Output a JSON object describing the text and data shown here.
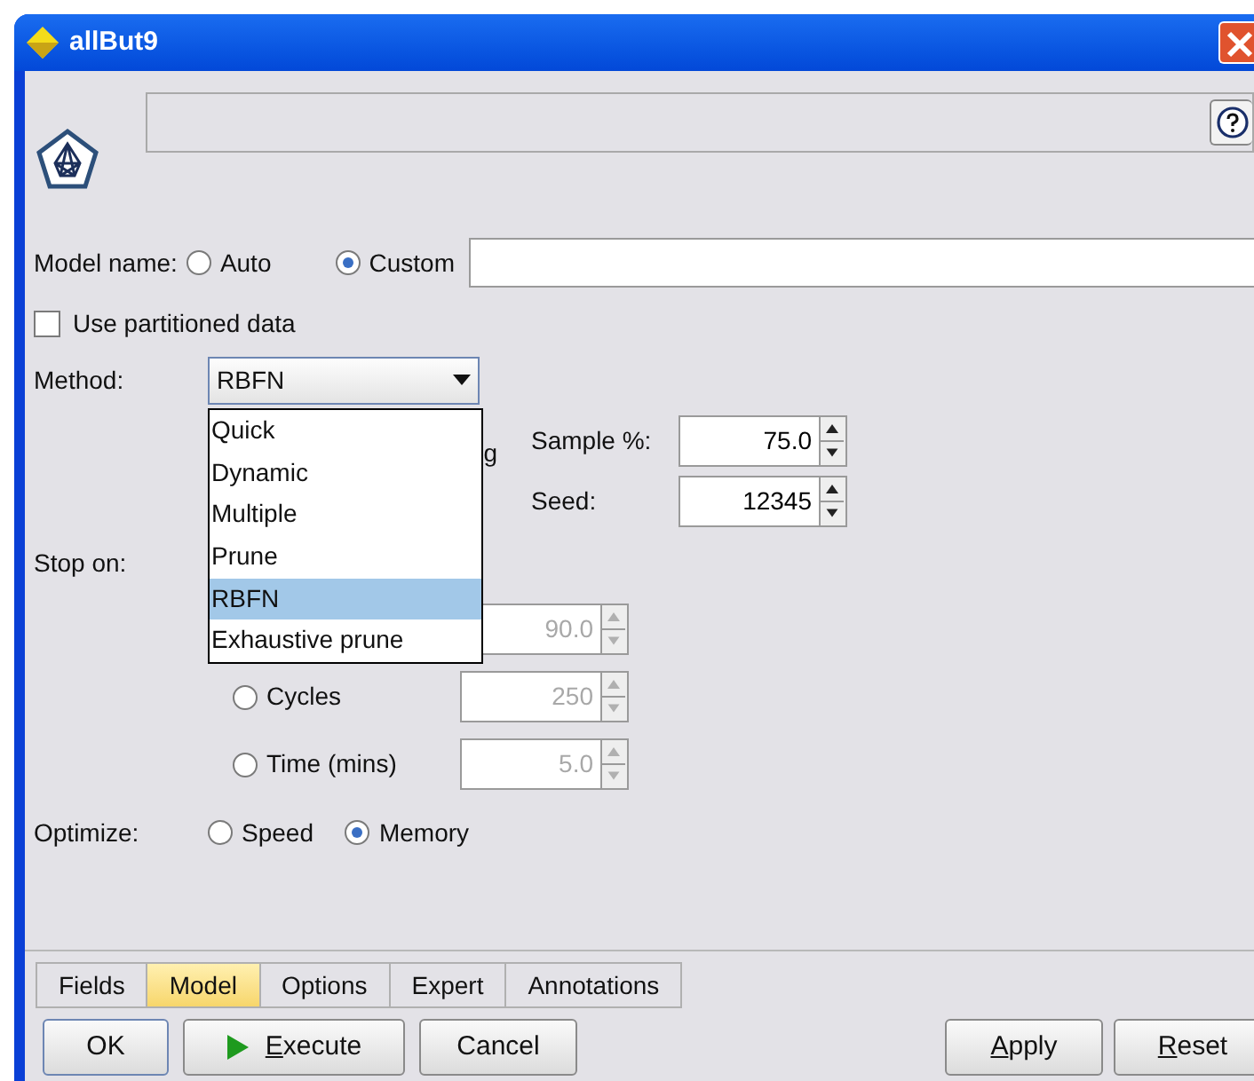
{
  "window": {
    "title": "allBut9"
  },
  "model_name": {
    "label": "Model name:",
    "options": [
      {
        "label": "Auto",
        "selected": false
      },
      {
        "label": "Custom",
        "selected": true
      }
    ]
  },
  "use_partitioned": {
    "label": "Use partitioned data",
    "checked": false
  },
  "method": {
    "label": "Method:",
    "value": "RBFN",
    "expanded": true,
    "options": [
      {
        "label": "Quick",
        "selected": false
      },
      {
        "label": "Dynamic",
        "selected": false
      },
      {
        "label": "Multiple",
        "selected": false
      },
      {
        "label": "Prune",
        "selected": false
      },
      {
        "label": "RBFN",
        "selected": true
      },
      {
        "label": "Exhaustive prune",
        "selected": false
      }
    ]
  },
  "hidden_fragment": "g",
  "sample": {
    "label": "Sample %:",
    "value": "75.0"
  },
  "seed": {
    "label": "Seed:",
    "value": "12345"
  },
  "stop_on": {
    "label": "Stop on:",
    "options": [
      {
        "value": "90.0",
        "disabled": true
      },
      {
        "label": "Cycles",
        "value": "250",
        "selected": false,
        "disabled": true
      },
      {
        "label": "Time (mins)",
        "value": "5.0",
        "selected": false,
        "disabled": true
      }
    ]
  },
  "optimize": {
    "label": "Optimize:",
    "options": [
      {
        "label": "Speed",
        "selected": false
      },
      {
        "label": "Memory",
        "selected": true
      }
    ]
  },
  "tabs": [
    {
      "label": "Fields",
      "selected": false
    },
    {
      "label": "Model",
      "selected": true
    },
    {
      "label": "Options",
      "selected": false
    },
    {
      "label": "Expert",
      "selected": false
    },
    {
      "label": "Annotations",
      "selected": false
    }
  ],
  "buttons_left": [
    {
      "label": "OK",
      "kind": "default",
      "mnemonic": false
    },
    {
      "label": "Execute",
      "kind": "run",
      "mnemonic": true
    },
    {
      "label": "Cancel",
      "kind": "plain",
      "mnemonic": false
    }
  ],
  "buttons_right": [
    {
      "label": "Apply",
      "kind": "plain",
      "mnemonic": true
    },
    {
      "label": "Reset",
      "kind": "plain",
      "mnemonic": true
    }
  ]
}
